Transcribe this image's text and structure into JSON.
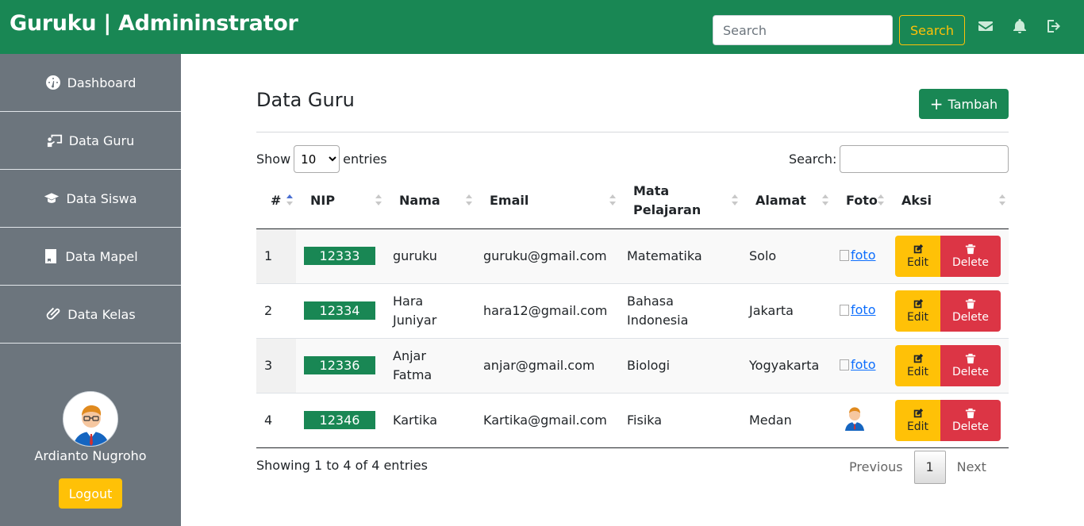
{
  "header": {
    "brand": "Guruku | Admininstrator",
    "search_placeholder": "Search",
    "search_button": "Search"
  },
  "sidebar": {
    "items": [
      {
        "label": "Dashboard",
        "icon": "dashboard-icon"
      },
      {
        "label": "Data Guru",
        "icon": "teacher-icon"
      },
      {
        "label": "Data Siswa",
        "icon": "graduation-cap-icon"
      },
      {
        "label": "Data Mapel",
        "icon": "book-icon"
      },
      {
        "label": "Data Kelas",
        "icon": "paperclip-icon"
      }
    ],
    "user_name": "Ardianto Nugroho",
    "logout_label": "Logout"
  },
  "main": {
    "title": "Data Guru",
    "add_label": "Tambah",
    "show_label": "Show",
    "entries_label": "entries",
    "page_size": "10",
    "search_label": "Search:",
    "columns": [
      "#",
      "NIP",
      "Nama",
      "Email",
      "Mata Pelajaran",
      "Alamat",
      "Foto",
      "Aksi"
    ],
    "rows": [
      {
        "no": "1",
        "nip": "12333",
        "nama": "guruku",
        "email": "guruku@gmail.com",
        "mapel": "Matematika",
        "alamat": "Solo",
        "foto": "foto"
      },
      {
        "no": "2",
        "nip": "12334",
        "nama": "Hara Juniyar",
        "email": "hara12@gmail.com",
        "mapel": "Bahasa Indonesia",
        "alamat": "Jakarta",
        "foto": "foto"
      },
      {
        "no": "3",
        "nip": "12336",
        "nama": "Anjar Fatma",
        "email": "anjar@gmail.com",
        "mapel": "Biologi",
        "alamat": "Yogyakarta",
        "foto": "foto"
      },
      {
        "no": "4",
        "nip": "12346",
        "nama": "Kartika",
        "email": "Kartika@gmail.com",
        "mapel": "Fisika",
        "alamat": "Medan",
        "foto": ""
      }
    ],
    "edit_label": "Edit",
    "delete_label": "Delete",
    "info": "Showing 1 to 4 of 4 entries",
    "pager": {
      "previous": "Previous",
      "current": "1",
      "next": "Next"
    }
  },
  "colors": {
    "primary": "#198754",
    "warning": "#ffc107",
    "danger": "#dc3545",
    "sidebar": "#6c757d"
  }
}
